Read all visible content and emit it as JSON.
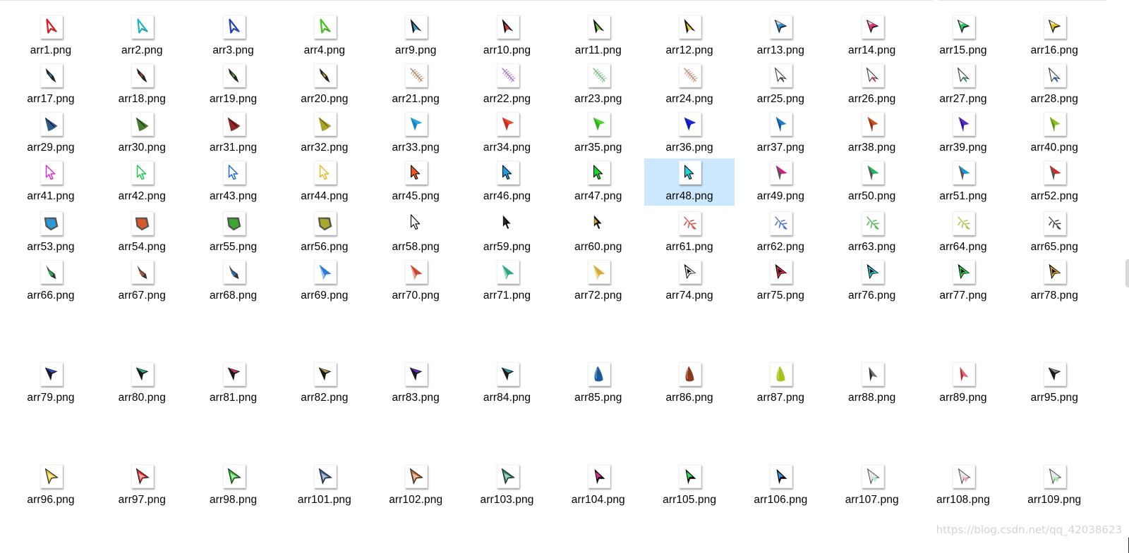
{
  "watermark": "https://blog.csdn.net/qq_42038623",
  "selected": "arr48.png",
  "files": [
    {
      "name": "arr1.png",
      "icon": "outline-arrow-icon",
      "color": "#d81e1e"
    },
    {
      "name": "arr2.png",
      "icon": "outline-arrow-icon",
      "color": "#17b5c6"
    },
    {
      "name": "arr3.png",
      "icon": "outline-arrow-icon",
      "color": "#1f3fc2"
    },
    {
      "name": "arr4.png",
      "icon": "outline-arrow-icon",
      "color": "#45c41f"
    },
    {
      "name": "arr9.png",
      "icon": "dark-arrow-icon",
      "color": "#3aa0d8"
    },
    {
      "name": "arr10.png",
      "icon": "dark-arrow-icon",
      "color": "#d43a3a"
    },
    {
      "name": "arr11.png",
      "icon": "dark-arrow-icon",
      "color": "#7ed04a"
    },
    {
      "name": "arr12.png",
      "icon": "dark-arrow-icon",
      "color": "#e6d12c"
    },
    {
      "name": "arr13.png",
      "icon": "gradient-arrow-icon",
      "color": "#2e8fd6"
    },
    {
      "name": "arr14.png",
      "icon": "gradient-arrow-icon",
      "color": "#e23b7a"
    },
    {
      "name": "arr15.png",
      "icon": "gradient-arrow-icon",
      "color": "#2fc35e"
    },
    {
      "name": "arr16.png",
      "icon": "gradient-arrow-icon",
      "color": "#e0c42a"
    },
    {
      "name": "arr17.png",
      "icon": "rocket-arrow-icon",
      "color": "#2b8ac8"
    },
    {
      "name": "arr18.png",
      "icon": "rocket-arrow-icon",
      "color": "#c8462b"
    },
    {
      "name": "arr19.png",
      "icon": "rocket-arrow-icon",
      "color": "#5dbb2b"
    },
    {
      "name": "arr20.png",
      "icon": "rocket-arrow-icon",
      "color": "#d7b52b"
    },
    {
      "name": "arr21.png",
      "icon": "feather-arrow-icon",
      "color": "#b48a6a"
    },
    {
      "name": "arr22.png",
      "icon": "feather-arrow-icon",
      "color": "#a97cc5"
    },
    {
      "name": "arr23.png",
      "icon": "feather-arrow-icon",
      "color": "#7bc08b"
    },
    {
      "name": "arr24.png",
      "icon": "feather-arrow-icon",
      "color": "#c7917e"
    },
    {
      "name": "arr25.png",
      "icon": "wire-arrow-icon",
      "color": "#444444"
    },
    {
      "name": "arr26.png",
      "icon": "wire-arrow-icon",
      "color": "#c43a4a"
    },
    {
      "name": "arr27.png",
      "icon": "wire-arrow-icon",
      "color": "#2a9a6a"
    },
    {
      "name": "arr28.png",
      "icon": "wire-arrow-icon",
      "color": "#2a5aa8"
    },
    {
      "name": "arr29.png",
      "icon": "leaf-arrow-icon",
      "color": "#2c5a82"
    },
    {
      "name": "arr30.png",
      "icon": "leaf-arrow-icon",
      "color": "#4c7a2e"
    },
    {
      "name": "arr31.png",
      "icon": "leaf-arrow-icon",
      "color": "#8a2a2a"
    },
    {
      "name": "arr32.png",
      "icon": "leaf-arrow-icon",
      "color": "#a9a22a"
    },
    {
      "name": "arr33.png",
      "icon": "flat-arrow-icon",
      "color": "#27a8e0"
    },
    {
      "name": "arr34.png",
      "icon": "flat-arrow-icon",
      "color": "#e8452a"
    },
    {
      "name": "arr35.png",
      "icon": "flat-arrow-icon",
      "color": "#4ad42a"
    },
    {
      "name": "arr36.png",
      "icon": "flat-arrow-icon",
      "color": "#1a2ad8"
    },
    {
      "name": "arr37.png",
      "icon": "slim-arrow-icon",
      "color": "#1f7ec8"
    },
    {
      "name": "arr38.png",
      "icon": "slim-arrow-icon",
      "color": "#c8521f"
    },
    {
      "name": "arr39.png",
      "icon": "slim-arrow-icon",
      "color": "#5a2ac8"
    },
    {
      "name": "arr40.png",
      "icon": "slim-arrow-icon",
      "color": "#8ac21f"
    },
    {
      "name": "arr41.png",
      "icon": "classic-outline-icon",
      "color": "#e02ad0"
    },
    {
      "name": "arr42.png",
      "icon": "classic-outline-icon",
      "color": "#1ec84a"
    },
    {
      "name": "arr43.png",
      "icon": "classic-outline-icon",
      "color": "#1f6ae0"
    },
    {
      "name": "arr44.png",
      "icon": "classic-outline-icon",
      "color": "#e8b82a"
    },
    {
      "name": "arr45.png",
      "icon": "classic-filled-icon",
      "color": "#f05a1a"
    },
    {
      "name": "arr46.png",
      "icon": "classic-filled-icon",
      "color": "#1aa0e8"
    },
    {
      "name": "arr47.png",
      "icon": "classic-filled-icon",
      "color": "#1ed22a"
    },
    {
      "name": "arr48.png",
      "icon": "classic-filled-icon",
      "color": "#1ad8d8"
    },
    {
      "name": "arr49.png",
      "icon": "split-arrow-icon",
      "color": "#d81a8a"
    },
    {
      "name": "arr50.png",
      "icon": "split-arrow-icon",
      "color": "#1ab85a"
    },
    {
      "name": "arr51.png",
      "icon": "split-arrow-icon",
      "color": "#1a9ad8"
    },
    {
      "name": "arr52.png",
      "icon": "split-arrow-icon",
      "color": "#d82a2a"
    },
    {
      "name": "arr53.png",
      "icon": "shield-arrow-icon",
      "color": "#2a9ad8"
    },
    {
      "name": "arr54.png",
      "icon": "shield-arrow-icon",
      "color": "#d8582a"
    },
    {
      "name": "arr55.png",
      "icon": "shield-arrow-icon",
      "color": "#3aa82a"
    },
    {
      "name": "arr56.png",
      "icon": "shield-arrow-icon",
      "color": "#a8a82a"
    },
    {
      "name": "arr58.png",
      "icon": "white-arrow-icon",
      "color": "#ffffff",
      "glyph": true
    },
    {
      "name": "arr59.png",
      "icon": "black-arrow-icon",
      "color": "#1e3a1e",
      "glyph": true
    },
    {
      "name": "arr60.png",
      "icon": "black-arrow-icon",
      "color": "#d8a82a",
      "glyph": true
    },
    {
      "name": "arr61.png",
      "icon": "sparkle-arrow-icon",
      "color": "#d84a4a"
    },
    {
      "name": "arr62.png",
      "icon": "sparkle-arrow-icon",
      "color": "#4a6ad8"
    },
    {
      "name": "arr63.png",
      "icon": "sparkle-arrow-icon",
      "color": "#4ab84a"
    },
    {
      "name": "arr64.png",
      "icon": "sparkle-arrow-icon",
      "color": "#a8c84a"
    },
    {
      "name": "arr65.png",
      "icon": "sparkle-arrow-icon",
      "color": "#444444"
    },
    {
      "name": "arr66.png",
      "icon": "bug-arrow-icon",
      "color": "#2aa84a"
    },
    {
      "name": "arr67.png",
      "icon": "bug-arrow-icon",
      "color": "#a8583a"
    },
    {
      "name": "arr68.png",
      "icon": "bug-arrow-icon",
      "color": "#2a6a9a"
    },
    {
      "name": "arr69.png",
      "icon": "cone-arrow-icon",
      "color": "#2a7ad8"
    },
    {
      "name": "arr70.png",
      "icon": "cone-arrow-icon",
      "color": "#c84a2a"
    },
    {
      "name": "arr71.png",
      "icon": "cone-arrow-icon",
      "color": "#2aa87a"
    },
    {
      "name": "arr72.png",
      "icon": "cone-arrow-icon",
      "color": "#d8a82a"
    },
    {
      "name": "arr74.png",
      "icon": "glow-arrow-icon",
      "color": "#ffffff"
    },
    {
      "name": "arr75.png",
      "icon": "glow-arrow-icon",
      "color": "#e82a4a"
    },
    {
      "name": "arr76.png",
      "icon": "glow-arrow-icon",
      "color": "#2ad8e8"
    },
    {
      "name": "arr77.png",
      "icon": "glow-arrow-icon",
      "color": "#2ae84a"
    },
    {
      "name": "arr78.png",
      "icon": "glow-arrow-icon",
      "color": "#e8a82a"
    },
    {
      "name": "arr79.png",
      "icon": "bevel-arrow-icon",
      "color": "#2a4ad8"
    },
    {
      "name": "arr80.png",
      "icon": "bevel-arrow-icon",
      "color": "#1ab88a"
    },
    {
      "name": "arr81.png",
      "icon": "bevel-arrow-icon",
      "color": "#d82a6a"
    },
    {
      "name": "arr82.png",
      "icon": "bevel-arrow-icon",
      "color": "#a89a4a"
    },
    {
      "name": "arr83.png",
      "icon": "bevel-arrow-icon",
      "color": "#6a2ad8"
    },
    {
      "name": "arr84.png",
      "icon": "bevel-arrow-icon",
      "color": "#2a9a9a"
    },
    {
      "name": "arr85.png",
      "icon": "blob-arrow-icon",
      "color": "#1a5a9a"
    },
    {
      "name": "arr86.png",
      "icon": "blob-arrow-icon",
      "color": "#8a3a1a"
    },
    {
      "name": "arr87.png",
      "icon": "blob-arrow-icon",
      "color": "#a8c21a"
    },
    {
      "name": "arr88.png",
      "icon": "thin-arrow-icon",
      "color": "#222222"
    },
    {
      "name": "arr89.png",
      "icon": "thin-arrow-icon",
      "color": "#c81a2a"
    },
    {
      "name": "arr95.png",
      "icon": "bevel-arrow-icon",
      "color": "#888888"
    },
    {
      "name": "arr96.png",
      "icon": "ring-arrow-icon",
      "color": "#e8c82a"
    },
    {
      "name": "arr97.png",
      "icon": "ring-arrow-icon",
      "color": "#e82a2a"
    },
    {
      "name": "arr98.png",
      "icon": "ring-arrow-icon",
      "color": "#2ac82a"
    },
    {
      "name": "arr101.png",
      "icon": "ring-arrow-icon",
      "color": "#3a6a9a"
    },
    {
      "name": "arr102.png",
      "icon": "ring-arrow-icon",
      "color": "#c86a2a"
    },
    {
      "name": "arr103.png",
      "icon": "ring-arrow-icon",
      "color": "#2a8a6a"
    },
    {
      "name": "arr104.png",
      "icon": "shadow-arrow-icon",
      "color": "#e82a9a"
    },
    {
      "name": "arr105.png",
      "icon": "shadow-arrow-icon",
      "color": "#2ae85a"
    },
    {
      "name": "arr106.png",
      "icon": "shadow-arrow-icon",
      "color": "#2a9ae8"
    },
    {
      "name": "arr107.png",
      "icon": "pale-arrow-icon",
      "color": "#b8e8d8"
    },
    {
      "name": "arr108.png",
      "icon": "pale-arrow-icon",
      "color": "#e8a8b8"
    },
    {
      "name": "arr109.png",
      "icon": "pale-arrow-icon",
      "color": "#a8e8a8"
    }
  ]
}
